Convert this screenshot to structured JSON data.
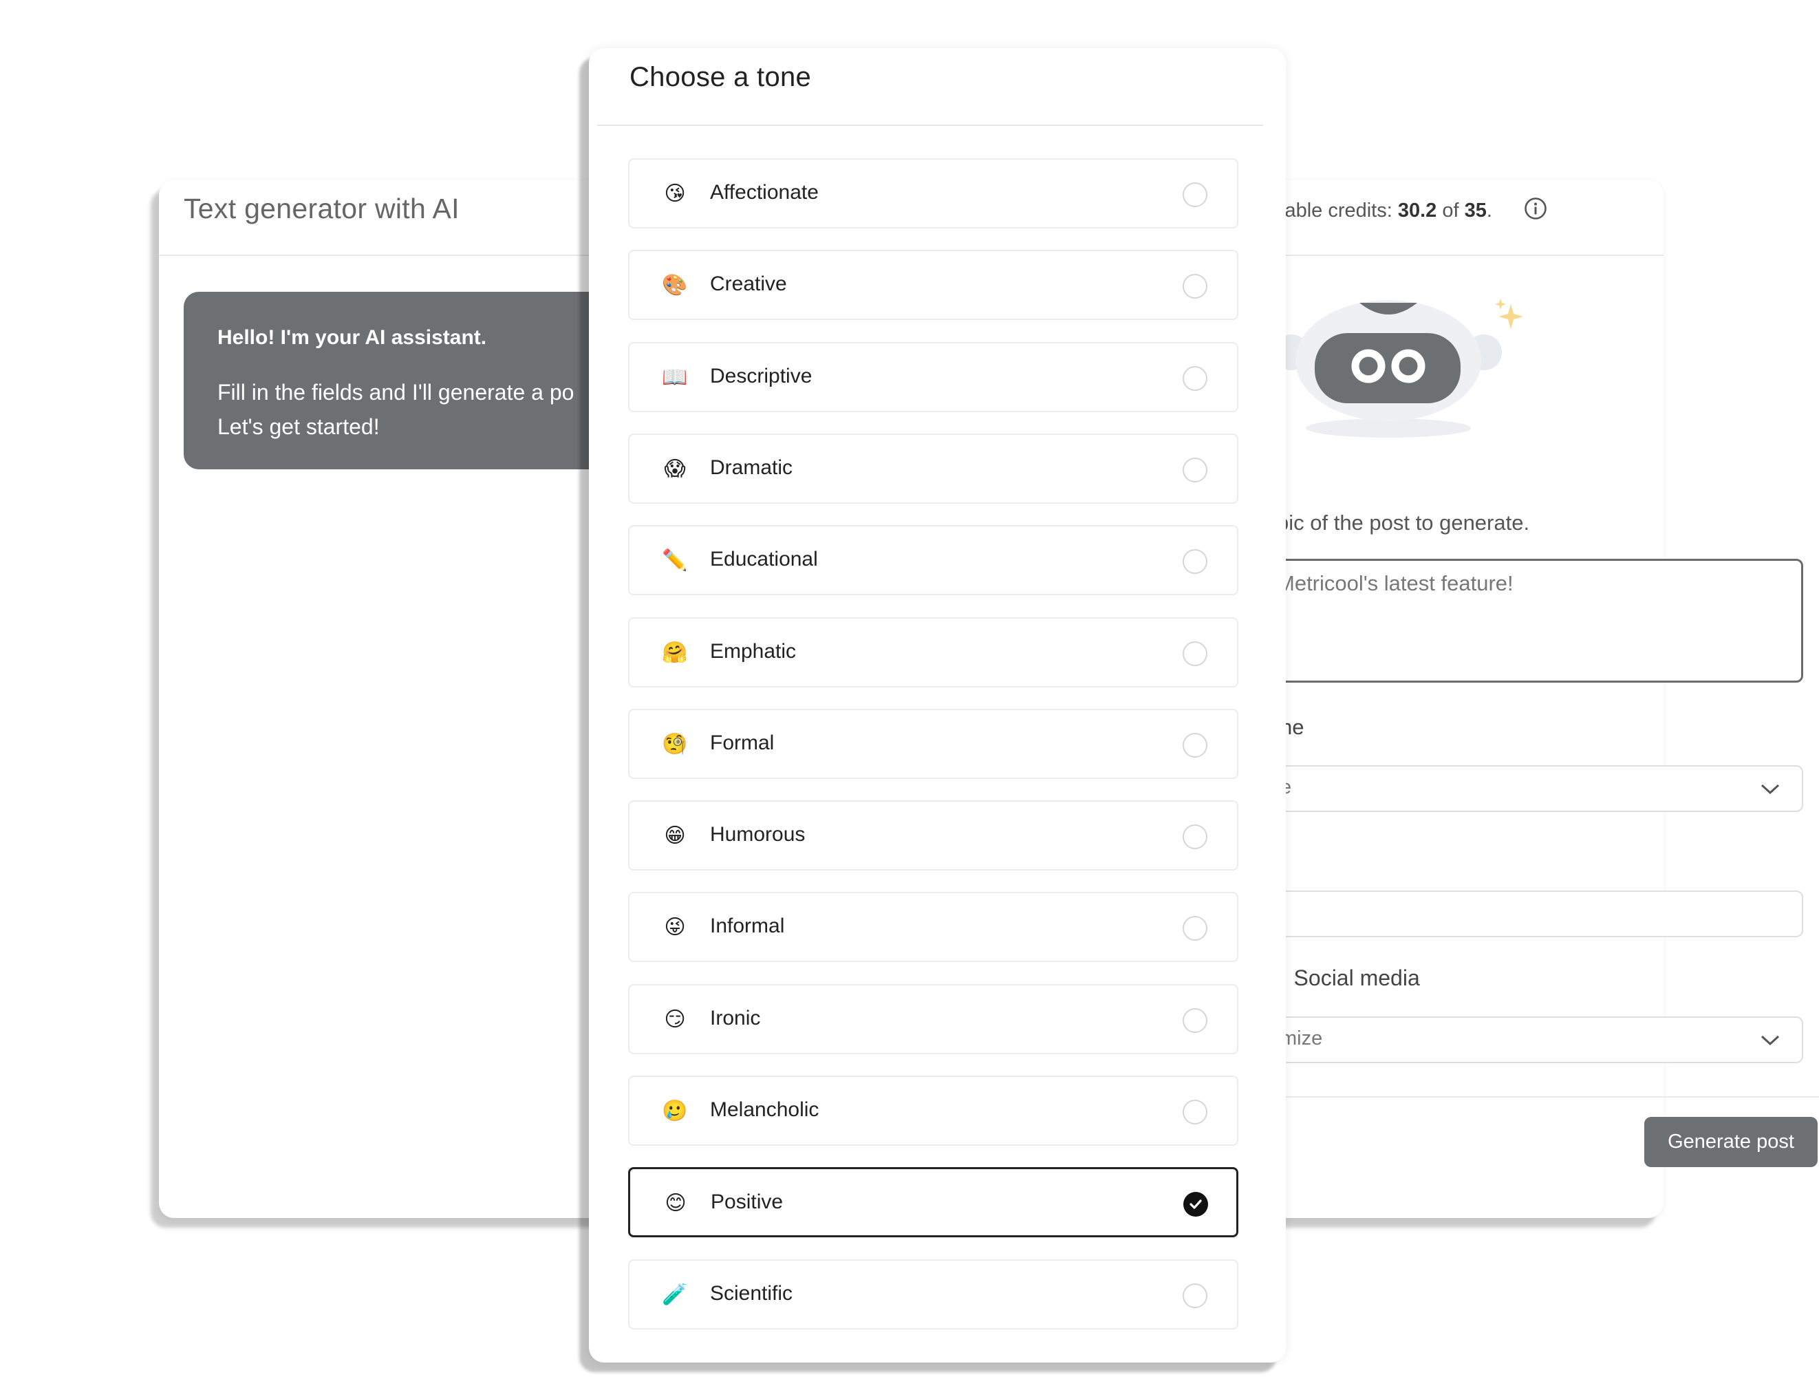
{
  "app": {
    "title": "Text generator with AI",
    "credits": {
      "prefix": "lable credits: ",
      "used": "30.2",
      "of": " of ",
      "total": "35",
      "suffix": "."
    },
    "assistant": {
      "greeting": "Hello! I'm your AI assistant.",
      "line1": "Fill in the fields and I'll generate a po",
      "line2": "Let's get started!"
    },
    "form": {
      "topic_label": "pic of the post to generate.",
      "topic_value": "Metricool's latest feature!",
      "tone_label": "ne",
      "tone_value": "e",
      "third_value": "",
      "social_label": "· Social media",
      "social_value": "mize",
      "generate_label": "Generate post"
    }
  },
  "modal": {
    "title": "Choose a tone",
    "options": [
      {
        "label": "Affectionate",
        "emoji": "😘",
        "selected": false
      },
      {
        "label": "Creative",
        "emoji": "🎨",
        "selected": false
      },
      {
        "label": "Descriptive",
        "emoji": "📖",
        "selected": false
      },
      {
        "label": "Dramatic",
        "emoji": "😱",
        "selected": false
      },
      {
        "label": "Educational",
        "emoji": "✏️",
        "selected": false
      },
      {
        "label": "Emphatic",
        "emoji": "🤗",
        "selected": false
      },
      {
        "label": "Formal",
        "emoji": "🧐",
        "selected": false
      },
      {
        "label": "Humorous",
        "emoji": "😁",
        "selected": false
      },
      {
        "label": "Informal",
        "emoji": "😜",
        "selected": false
      },
      {
        "label": "Ironic",
        "emoji": "😏",
        "selected": false
      },
      {
        "label": "Melancholic",
        "emoji": "🥲",
        "selected": false
      },
      {
        "label": "Positive",
        "emoji": "😊",
        "selected": true
      },
      {
        "label": "Scientific",
        "emoji": "🧪",
        "selected": false
      }
    ]
  },
  "colors": {
    "bubble_bg": "#6d7072",
    "button_bg": "#6d7072",
    "selected_border": "#222222"
  }
}
